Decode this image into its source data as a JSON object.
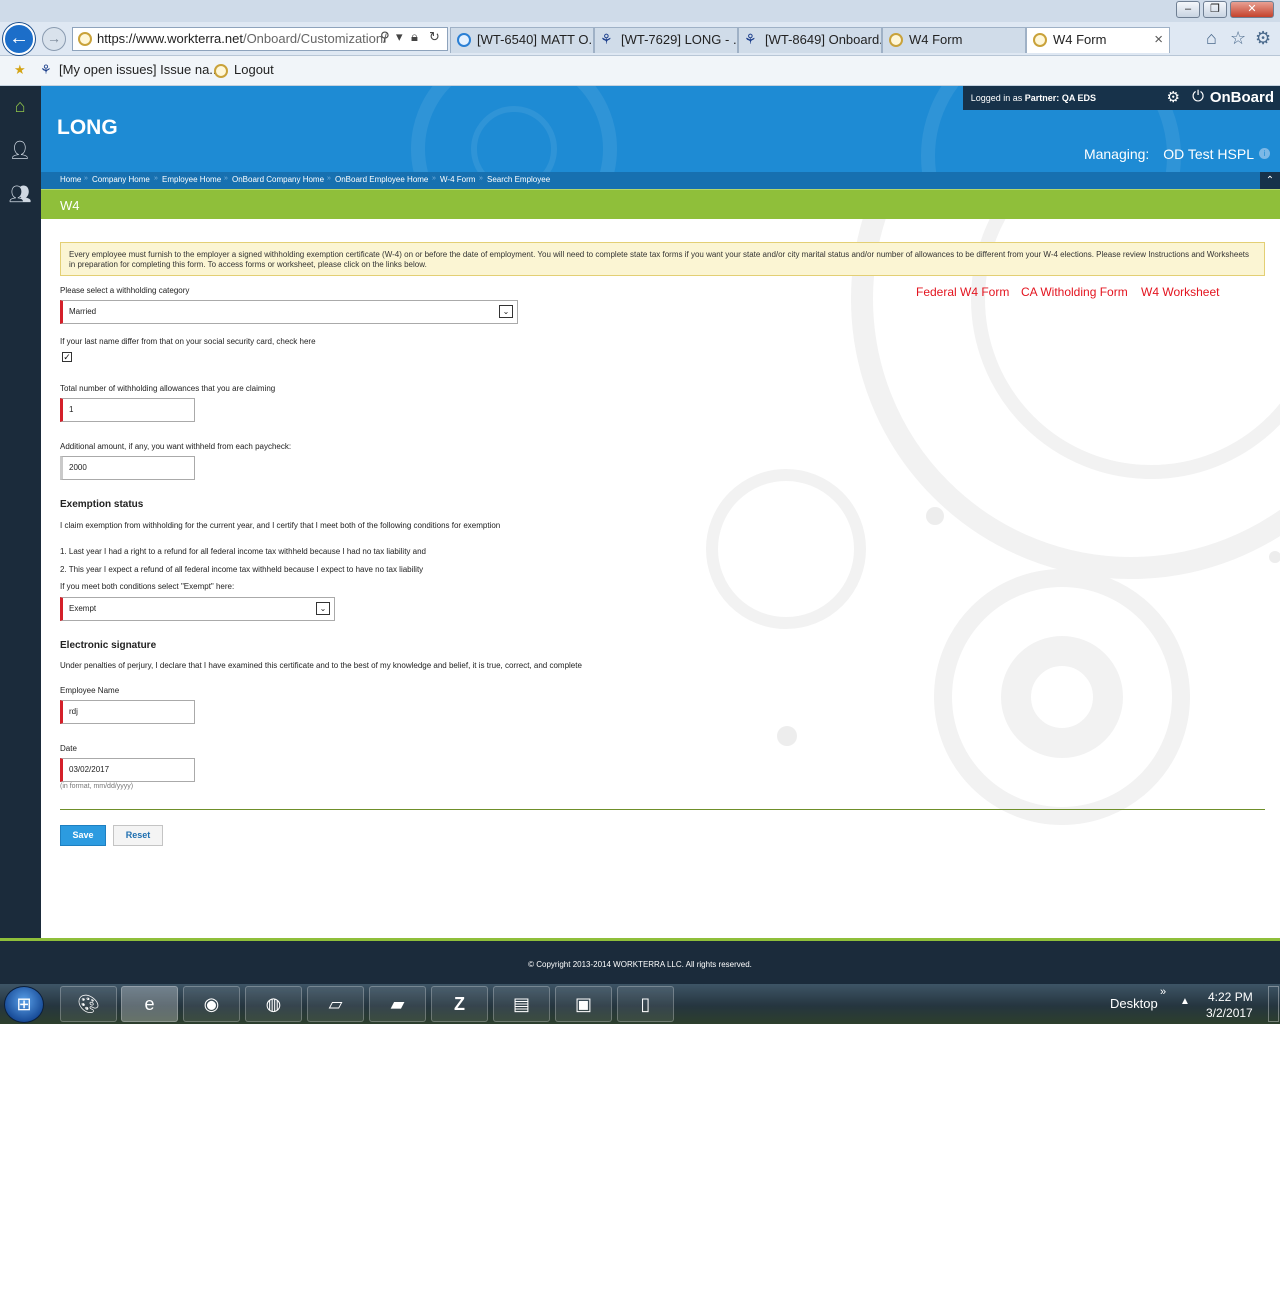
{
  "browser": {
    "url_host": "https://www.workterra.net",
    "url_path": "/Onboard/Customization/",
    "tabs": [
      {
        "label": "[WT-6540] MATT O..."
      },
      {
        "label": "[WT-7629] LONG - ..."
      },
      {
        "label": "[WT-8649] Onboard..."
      },
      {
        "label": "W4 Form"
      },
      {
        "label": "W4 Form"
      }
    ],
    "favorites": [
      {
        "label": "[My open issues] Issue na..."
      },
      {
        "label": "Logout"
      }
    ]
  },
  "header": {
    "site_title": "LONG",
    "logged_in_prefix": "Logged in as",
    "partner_label": "Partner:",
    "partner_value": "QA EDS",
    "brand": "OnBoard",
    "managing_label": "Managing:",
    "managing_value": "OD Test HSPL"
  },
  "breadcrumb": [
    "Home",
    "Company Home",
    "Employee Home",
    "OnBoard Company Home",
    "OnBoard Employee Home",
    "W-4 Form",
    "Search Employee"
  ],
  "page_title": "W4",
  "notice": "Every employee must furnish to the employer a signed withholding exemption certificate (W-4) on or before the date of employment. You will need to complete state tax forms if you want your state and/or city marital status and/or number of allowances to be different from your W-4 elections. Please review Instructions and Worksheets in preparation for completing this form. To access forms or worksheet, please click on the links below.",
  "links": [
    "Federal W4 Form",
    "CA Witholding Form",
    "W4 Worksheet"
  ],
  "form": {
    "category_label": "Please select a withholding category",
    "category_value": "Married",
    "lastname_label": "If your last name differ from that on your social security card, check here",
    "lastname_checked": "✓",
    "allowances_label": "Total number of withholding allowances that you are claiming",
    "allowances_value": "1",
    "additional_label": "Additional amount, if any, you want withheld from each paycheck:",
    "additional_value": "2000",
    "exemption_heading": "Exemption status",
    "exemption_intro": "I claim exemption from withholding for the current year, and I certify that I meet both of the following conditions for exemption",
    "condition_1": "1. Last year I had a right to a refund for all federal income tax withheld because I had no tax liability and",
    "condition_2": "2. This year I expect a refund of all federal income tax withheld because I expect to have no tax liability",
    "exempt_prompt": "If you meet both conditions select \"Exempt\" here:",
    "exempt_value": "Exempt",
    "signature_heading": "Electronic signature",
    "signature_text": "Under penalties of perjury, I declare that I have examined this certificate and to the best of my knowledge and belief, it is true, correct, and complete",
    "name_label": "Employee Name",
    "name_value": "rdj",
    "date_label": "Date",
    "date_value": "03/02/2017",
    "date_hint": "(in format, mm/dd/yyyy)",
    "save_label": "Save",
    "reset_label": "Reset"
  },
  "footer": {
    "copyright": "© Copyright 2013-2014 WORKTERRA LLC. All rights reserved."
  },
  "taskbar": {
    "desktop_label": "Desktop",
    "time": "4:22 PM",
    "date": "3/2/2017"
  },
  "colors": {
    "header_blue": "#1e8bd4",
    "sidebar_navy": "#1b2b3b",
    "accent_green": "#8fbf3a",
    "link_red": "#e3141f",
    "required_red": "#d4202a"
  }
}
